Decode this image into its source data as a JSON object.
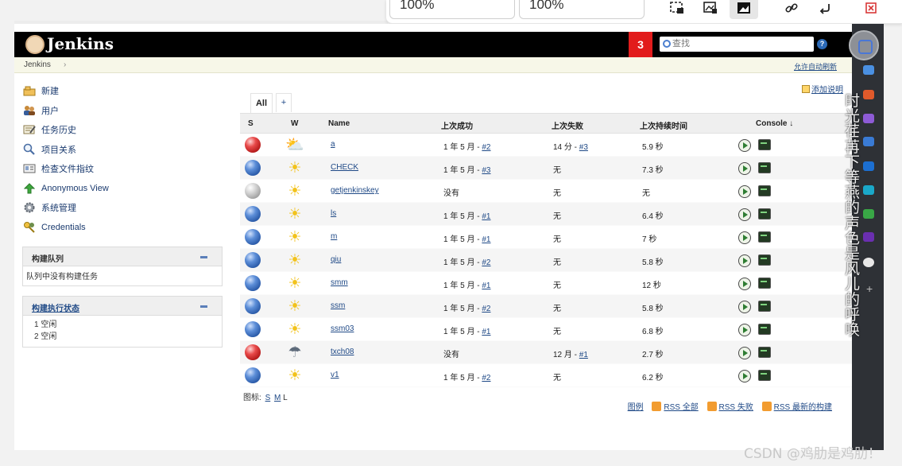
{
  "toolbar": {
    "zoom1": "100%",
    "zoom2": "100%",
    "buttons": [
      "crop-select-icon",
      "image-crop-icon",
      "image-icon",
      "link-icon",
      "undo-icon",
      "close-icon"
    ]
  },
  "jenkins": {
    "title": "Jenkins",
    "build_badge": "3",
    "search_placeholder": "查找",
    "help": "?",
    "breadcrumb": "Jenkins",
    "crumb_sep": "›",
    "auto_refresh": "允许自动刷新",
    "add_description": "添加说明"
  },
  "sidebar": {
    "items": [
      {
        "label": "新建",
        "icon": "new-item-icon"
      },
      {
        "label": "用户",
        "icon": "users-icon"
      },
      {
        "label": "任务历史",
        "icon": "history-icon"
      },
      {
        "label": "项目关系",
        "icon": "search-icon"
      },
      {
        "label": "检查文件指纹",
        "icon": "fingerprint-icon"
      },
      {
        "label": "Anonymous View",
        "icon": "up-arrow-icon"
      },
      {
        "label": "系统管理",
        "icon": "gear-icon"
      },
      {
        "label": "Credentials",
        "icon": "credentials-icon"
      }
    ]
  },
  "queue": {
    "title": "构建队列",
    "empty": "队列中没有构建任务"
  },
  "executors": {
    "title": "构建执行状态",
    "rows": [
      "1  空闲",
      "2  空闲"
    ]
  },
  "tabs": {
    "all": "All",
    "add": "+"
  },
  "table": {
    "headers": {
      "s": "S",
      "w": "W",
      "name": "Name",
      "last_success": "上次成功",
      "last_failure": "上次失败",
      "duration": "上次持续时间",
      "console": "Console  ↓"
    },
    "rows": [
      {
        "status": "red",
        "weather": "cloudy",
        "name": "a",
        "succ_text": "1 年 5 月 - ",
        "succ_link": "#2",
        "fail_text": "14 分 - ",
        "fail_link": "#3",
        "duration": "5.9 秒"
      },
      {
        "status": "blue",
        "weather": "sunny",
        "name": "CHECK",
        "succ_text": "1 年 5 月 - ",
        "succ_link": "#3",
        "fail_text": "无",
        "fail_link": "",
        "duration": "7.3 秒"
      },
      {
        "status": "grey",
        "weather": "sunny",
        "name": "getjenkinskey",
        "succ_text": "没有",
        "succ_link": "",
        "fail_text": "无",
        "fail_link": "",
        "duration": "无"
      },
      {
        "status": "blue",
        "weather": "sunny",
        "name": "ls",
        "succ_text": "1 年 5 月 - ",
        "succ_link": "#1",
        "fail_text": "无",
        "fail_link": "",
        "duration": "6.4 秒"
      },
      {
        "status": "blue",
        "weather": "sunny",
        "name": "m",
        "succ_text": "1 年 5 月 - ",
        "succ_link": "#1",
        "fail_text": "无",
        "fail_link": "",
        "duration": "7 秒"
      },
      {
        "status": "blue",
        "weather": "sunny",
        "name": "qiu",
        "succ_text": "1 年 5 月 - ",
        "succ_link": "#2",
        "fail_text": "无",
        "fail_link": "",
        "duration": "5.8 秒"
      },
      {
        "status": "blue",
        "weather": "sunny",
        "name": "smm",
        "succ_text": "1 年 5 月 - ",
        "succ_link": "#1",
        "fail_text": "无",
        "fail_link": "",
        "duration": "12 秒"
      },
      {
        "status": "blue",
        "weather": "sunny",
        "name": "ssm",
        "succ_text": "1 年 5 月 - ",
        "succ_link": "#2",
        "fail_text": "无",
        "fail_link": "",
        "duration": "5.8 秒"
      },
      {
        "status": "blue",
        "weather": "sunny",
        "name": "ssm03",
        "succ_text": "1 年 5 月 - ",
        "succ_link": "#1",
        "fail_text": "无",
        "fail_link": "",
        "duration": "6.8 秒"
      },
      {
        "status": "red",
        "weather": "storm",
        "name": "txch08",
        "succ_text": "没有",
        "succ_link": "",
        "fail_text": "12 月 - ",
        "fail_link": "#1",
        "duration": "2.7 秒"
      },
      {
        "status": "blue",
        "weather": "sunny",
        "name": "v1",
        "succ_text": "1 年 5 月 - ",
        "succ_link": "#2",
        "fail_text": "无",
        "fail_link": "",
        "duration": "6.2 秒"
      }
    ]
  },
  "legend": {
    "label": "图标:",
    "s": "S",
    "m": "M",
    "l": "L"
  },
  "rss": {
    "legend": "图例",
    "all": "RSS 全部",
    "failed": "RSS 失败",
    "latest": "RSS 最新的构建"
  },
  "overlay_text": "时光荏苒下等燕的声色是风儿的呼唤",
  "watermark": "CSDN @鸡肋是鸡肋！",
  "colors": {
    "status_blue": "#3a6fc4",
    "status_red": "#d32020",
    "status_grey": "#a8a8a8",
    "header_bg": "#000000",
    "badge_red": "#e21c1c"
  }
}
